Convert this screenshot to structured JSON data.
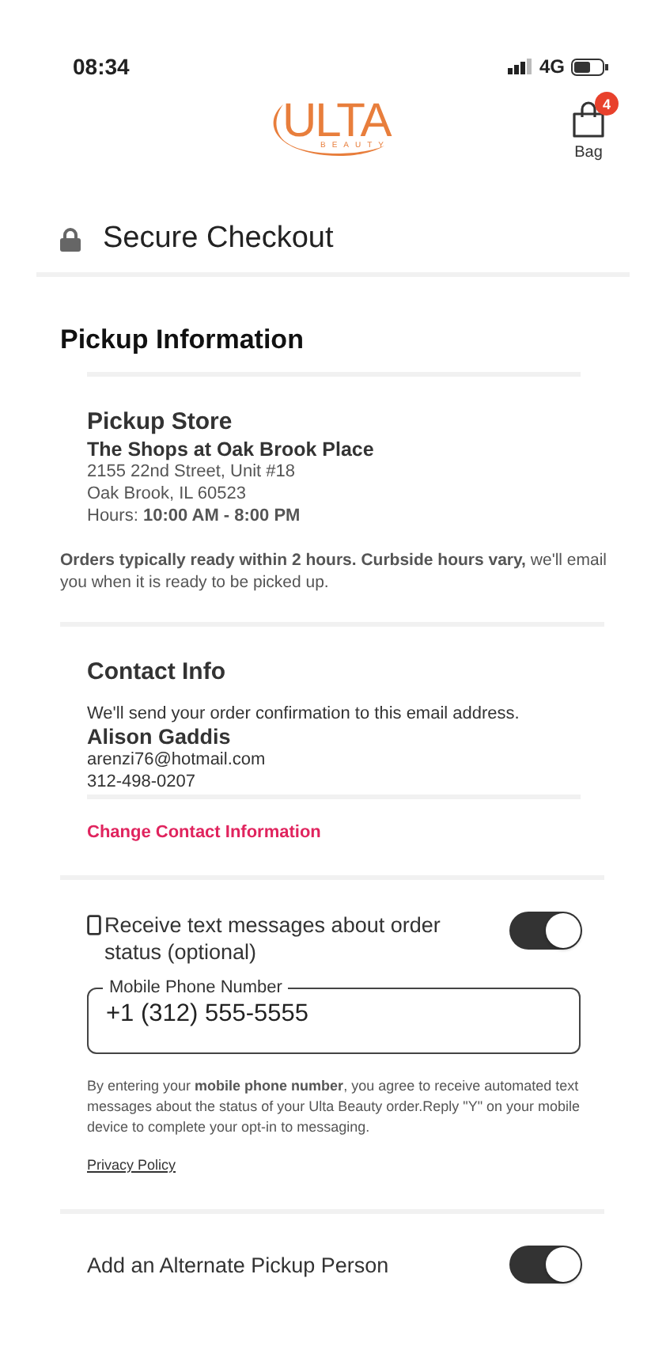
{
  "status_bar": {
    "time": "08:34",
    "network": "4G"
  },
  "header": {
    "logo": {
      "word": "ULTA",
      "subword": "BEAUTY"
    },
    "bag": {
      "label": "Bag",
      "count": "4"
    }
  },
  "page_title": "Secure Checkout",
  "pickup": {
    "heading": "Pickup Information",
    "store_heading": "Pickup Store",
    "store_name": "The Shops at Oak Brook Place",
    "address_lines": [
      "2155 22nd Street, Unit #18",
      "Oak Brook, IL 60523"
    ],
    "hours": "Hours: **10:00 AM - 8:00 PM**",
    "note": "**Orders typically ready within 2 hours. Curbside hours vary,** we'll email you when it is ready to be picked up."
  },
  "contact": {
    "heading": "Contact Info",
    "intro": "We'll send your order confirmation to this email address.",
    "name": "Alison Gaddis",
    "email": "arenzi76@hotmail.com",
    "phone": "312-498-0207",
    "change_link": "Change Contact Information"
  },
  "sms": {
    "label": "Receive text messages about order status (optional)",
    "on": true,
    "field": {
      "label": "Mobile Phone Number",
      "value": "+1 (312) 555-5555"
    },
    "disclaimer": "By entering your **mobile phone number**, you agree to receive automated text messages about the status of your Ulta Beauty order.Reply \"Y\" on your mobile device to complete your opt-in to messaging.",
    "privacy_link": "Privacy Policy"
  },
  "alternate": {
    "label": "Add an Alternate Pickup Person",
    "on": true
  }
}
